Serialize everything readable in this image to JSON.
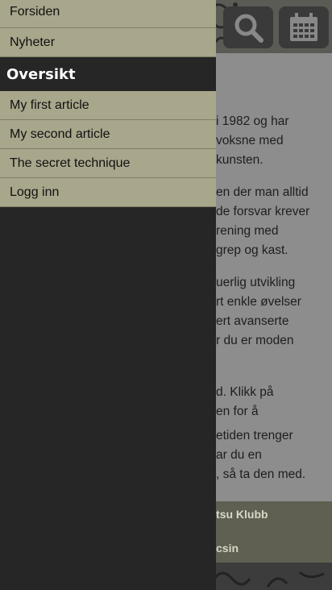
{
  "drawer": {
    "top_items": [
      {
        "label": "Forsiden"
      },
      {
        "label": "Nyheter"
      }
    ],
    "section_header": "Oversikt",
    "section_items": [
      {
        "label": "My first article"
      },
      {
        "label": "My second article"
      },
      {
        "label": "The secret technique"
      },
      {
        "label": "Logg inn"
      }
    ]
  },
  "header": {
    "icons": [
      "search-icon",
      "calendar-icon"
    ]
  },
  "content": {
    "lines": [
      "i 1982 og har",
      "voksne med",
      "kunsten.",
      "en der man alltid",
      "de forsvar krever",
      "rening med",
      "grep og kast.",
      "uerlig utvikling",
      "rt enkle øvelser",
      "ert avanserte",
      "r du er moden",
      "d. Klikk på",
      "en for å",
      "etiden trenger",
      "ar du en",
      ", så ta den med."
    ]
  },
  "footer": {
    "line1": "tsu Klubb",
    "line2": "csin"
  },
  "colors": {
    "menu_bg": "#a8a68b",
    "drawer_bg": "#262626",
    "header_text": "#ffffff"
  }
}
